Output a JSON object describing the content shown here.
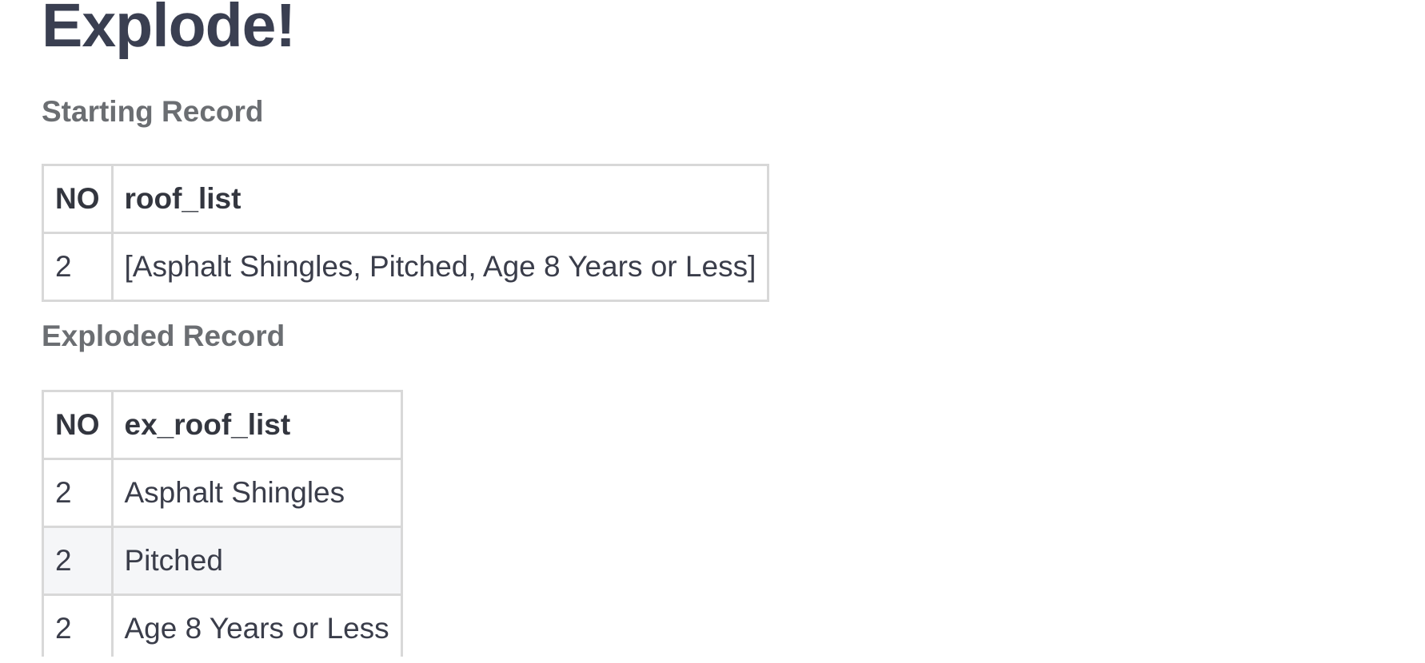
{
  "page_title": "Explode!",
  "starting_record": {
    "title": "Starting Record",
    "headers": [
      "NO",
      "roof_list"
    ],
    "rows": [
      [
        "2",
        "[Asphalt Shingles, Pitched, Age 8 Years or Less]"
      ]
    ]
  },
  "exploded_record": {
    "title": "Exploded Record",
    "headers": [
      "NO",
      "ex_roof_list"
    ],
    "rows": [
      [
        "2",
        "Asphalt Shingles"
      ],
      [
        "2",
        "Pitched"
      ],
      [
        "2",
        "Age 8 Years or Less"
      ]
    ]
  }
}
